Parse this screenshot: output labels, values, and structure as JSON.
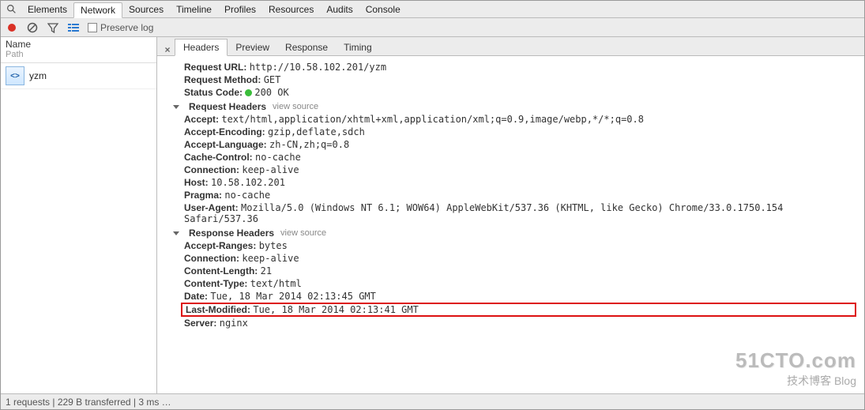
{
  "tabs": [
    "Elements",
    "Network",
    "Sources",
    "Timeline",
    "Profiles",
    "Resources",
    "Audits",
    "Console"
  ],
  "tabs_active_index": 1,
  "toolbar": {
    "preserve_label": "Preserve log"
  },
  "left": {
    "name_label": "Name",
    "path_label": "Path",
    "items": [
      {
        "name": "yzm",
        "icon": "<>"
      }
    ]
  },
  "detail_tabs": [
    "Headers",
    "Preview",
    "Response",
    "Timing"
  ],
  "detail_tabs_active_index": 0,
  "general": {
    "url_label": "Request URL:",
    "url_value": "http://10.58.102.201/yzm",
    "method_label": "Request Method:",
    "method_value": "GET",
    "status_label": "Status Code:",
    "status_value": "200 OK"
  },
  "request_headers": {
    "title": "Request Headers",
    "view_source": "view source",
    "items": [
      {
        "k": "Accept:",
        "v": "text/html,application/xhtml+xml,application/xml;q=0.9,image/webp,*/*;q=0.8"
      },
      {
        "k": "Accept-Encoding:",
        "v": "gzip,deflate,sdch"
      },
      {
        "k": "Accept-Language:",
        "v": "zh-CN,zh;q=0.8"
      },
      {
        "k": "Cache-Control:",
        "v": "no-cache"
      },
      {
        "k": "Connection:",
        "v": "keep-alive"
      },
      {
        "k": "Host:",
        "v": "10.58.102.201"
      },
      {
        "k": "Pragma:",
        "v": "no-cache"
      },
      {
        "k": "User-Agent:",
        "v": "Mozilla/5.0 (Windows NT 6.1; WOW64) AppleWebKit/537.36 (KHTML, like Gecko) Chrome/33.0.1750.154 Safari/537.36"
      }
    ]
  },
  "response_headers": {
    "title": "Response Headers",
    "view_source": "view source",
    "items": [
      {
        "k": "Accept-Ranges:",
        "v": "bytes"
      },
      {
        "k": "Connection:",
        "v": "keep-alive"
      },
      {
        "k": "Content-Length:",
        "v": "21"
      },
      {
        "k": "Content-Type:",
        "v": "text/html"
      },
      {
        "k": "Date:",
        "v": "Tue, 18 Mar 2014 02:13:45 GMT"
      },
      {
        "k": "Last-Modified:",
        "v": "Tue, 18 Mar 2014 02:13:41 GMT",
        "highlight": true
      },
      {
        "k": "Server:",
        "v": "nginx"
      }
    ]
  },
  "statusbar": "1 requests | 229 B transferred | 3 ms …",
  "watermark": {
    "line1": "51CTO.com",
    "line2": "技术博客     Blog"
  }
}
